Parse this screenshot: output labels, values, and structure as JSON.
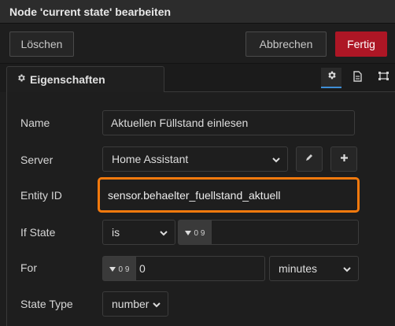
{
  "dialog": {
    "title": "Node 'current state' bearbeiten"
  },
  "toolbar": {
    "delete_label": "Löschen",
    "cancel_label": "Abbrechen",
    "done_label": "Fertig"
  },
  "tabs": {
    "properties_label": "Eigenschaften"
  },
  "icons": {
    "properties_tab": "gear-icon",
    "description_tab": "document-icon",
    "appearance_tab": "frame-icon",
    "edit_server": "pencil-icon",
    "add_server": "plus-icon",
    "dropdown": "chevron-down-icon",
    "numeric_type": "number-type-icon"
  },
  "colors": {
    "accent_red": "#ad1625",
    "highlight_orange": "#f57a0d",
    "active_tab_blue": "#3f8ed6"
  },
  "form": {
    "name": {
      "label": "Name",
      "value": "Aktuellen Füllstand einlesen"
    },
    "server": {
      "label": "Server",
      "value": "Home Assistant"
    },
    "entity_id": {
      "label": "Entity ID",
      "value": "sensor.behaelter_fuellstand_aktuell"
    },
    "if_state": {
      "label": "If State",
      "operator": "is",
      "type_glyph": "0 9",
      "value": ""
    },
    "for": {
      "label": "For",
      "type_glyph": "0 9",
      "value": "0",
      "unit": "minutes"
    },
    "state_type": {
      "label": "State Type",
      "value": "number"
    }
  }
}
